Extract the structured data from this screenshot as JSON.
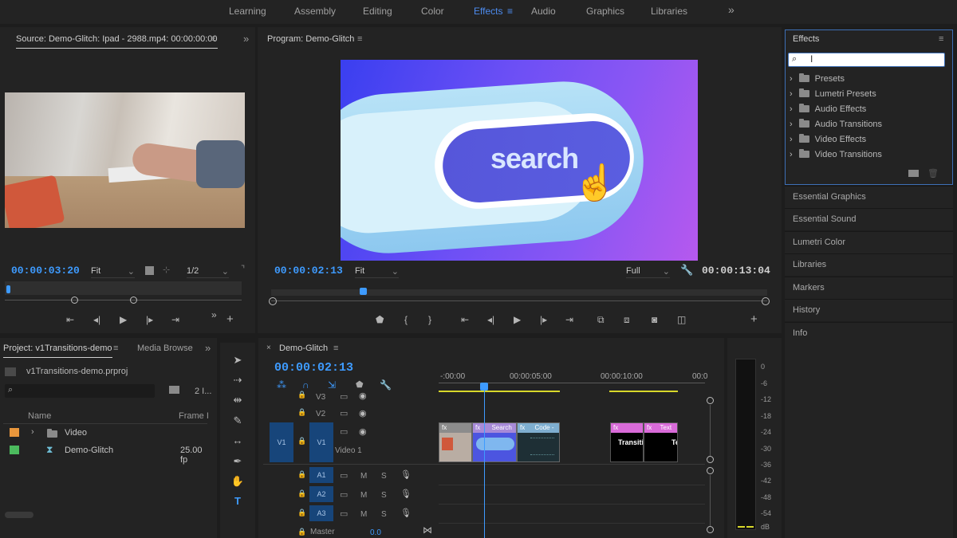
{
  "workspaces": {
    "items": [
      {
        "label": "Learning"
      },
      {
        "label": "Assembly"
      },
      {
        "label": "Editing"
      },
      {
        "label": "Color"
      },
      {
        "label": "Effects"
      },
      {
        "label": "Audio"
      },
      {
        "label": "Graphics"
      },
      {
        "label": "Libraries"
      }
    ],
    "active": "Effects",
    "overflow_icon": "double-chevron-right-icon"
  },
  "source": {
    "title": "Source: Demo-Glitch: Ipad - 2988.mp4: 00:00:00:00",
    "timecode": "00:00:03:20",
    "fit": "Fit",
    "resolution": "1/2"
  },
  "program": {
    "title": "Program: Demo-Glitch",
    "timecode": "00:00:02:13",
    "fit": "Fit",
    "quality": "Full",
    "duration": "00:00:13:04",
    "frame_text": "search"
  },
  "effects": {
    "title": "Effects",
    "search_value": "",
    "tree": [
      {
        "label": "Presets"
      },
      {
        "label": "Lumetri Presets"
      },
      {
        "label": "Audio Effects"
      },
      {
        "label": "Audio Transitions"
      },
      {
        "label": "Video Effects"
      },
      {
        "label": "Video Transitions"
      }
    ]
  },
  "side_panels": [
    {
      "label": "Essential Graphics"
    },
    {
      "label": "Essential Sound"
    },
    {
      "label": "Lumetri Color"
    },
    {
      "label": "Libraries"
    },
    {
      "label": "Markers"
    },
    {
      "label": "History"
    },
    {
      "label": "Info"
    }
  ],
  "project": {
    "tab": "Project: v1Transitions-demo",
    "tab2": "Media Browse",
    "file": "v1Transitions-demo.prproj",
    "count": "2 I...",
    "col_name": "Name",
    "col_frame": "Frame I",
    "rows": [
      {
        "name": "Video",
        "frame": "",
        "color": "#e8963c"
      },
      {
        "name": "Demo-Glitch",
        "frame": "25.00 fp",
        "color": "#4cbb5e"
      }
    ]
  },
  "timeline": {
    "tab": "Demo-Glitch",
    "timecode": "00:00:02:13",
    "ruler": [
      "-:00:00",
      "00:00:05:00",
      "00:00:10:00",
      "00:0"
    ],
    "tracks": {
      "v3": "V3",
      "v2": "V2",
      "v1": "V1",
      "v1_src": "V1",
      "video1": "Video 1",
      "a1": "A1",
      "a2": "A2",
      "a3": "A3",
      "m": "M",
      "s": "S",
      "master": "Master",
      "master_val": "0.0"
    },
    "clips": {
      "fx": "fx",
      "search": "Search",
      "code": "Code -",
      "transition": "Transitio",
      "text": "Text",
      "text_clip": "Te"
    }
  },
  "meter": {
    "labels": [
      "0",
      "-6",
      "-12",
      "-18",
      "-24",
      "-30",
      "-36",
      "-42",
      "-48",
      "-54",
      "dB"
    ]
  }
}
